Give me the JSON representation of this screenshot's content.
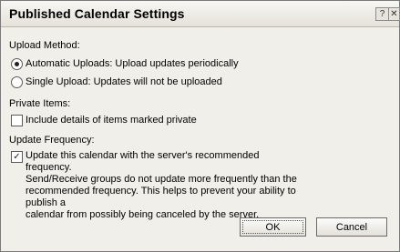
{
  "window": {
    "title": "Published Calendar Settings",
    "help_glyph": "?",
    "close_glyph": "✕"
  },
  "upload_method": {
    "label": "Upload Method:",
    "automatic_label": "Automatic Uploads: Upload updates periodically",
    "single_label": "Single Upload: Updates will not be uploaded",
    "selected": "automatic"
  },
  "private_items": {
    "label": "Private Items:",
    "include_label": "Include details of items marked private",
    "checked": false
  },
  "update_frequency": {
    "label": "Update Frequency:",
    "lines": [
      "Update this calendar with the server's recommended frequency.",
      "Send/Receive groups do not update more frequently than the",
      "recommended frequency.  This helps to prevent your ability to publish a",
      "calendar from possibly being canceled by the server."
    ],
    "checked": true,
    "check_glyph": "✓"
  },
  "buttons": {
    "ok": "OK",
    "cancel": "Cancel"
  }
}
